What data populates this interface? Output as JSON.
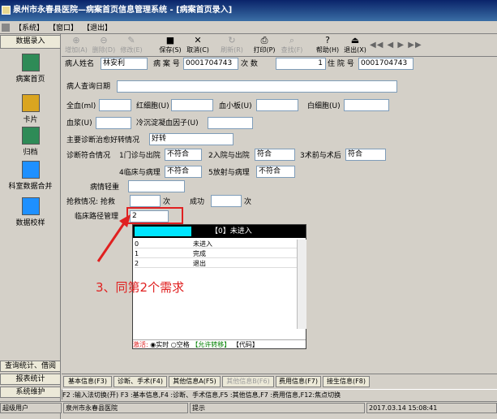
{
  "window": {
    "title": "泉州市永春县医院—病案首页信息管理系统 - [病案首页录入]"
  },
  "menu": [
    "【系统】",
    "【窗口】",
    "【退出】"
  ],
  "sidebar": {
    "header": "数据录入",
    "items": [
      {
        "label": "病案首页",
        "icon": "folder-document-icon",
        "color": "#2e8b57"
      },
      {
        "label": "卡片",
        "icon": "card-icon",
        "color": "#daa520"
      },
      {
        "label": "归档",
        "icon": "archive-icon",
        "color": "#2e8b57"
      },
      {
        "label": "科室数据合并",
        "icon": "merge-icon",
        "color": "#1e90ff"
      },
      {
        "label": "数据校样",
        "icon": "check-data-icon",
        "color": "#1e90ff"
      }
    ],
    "bottom": [
      "查询统计、借阅",
      "报表统计",
      "系统维护"
    ]
  },
  "toolbar": [
    {
      "label": "增加(A)",
      "glyph": "⊕",
      "enabled": false
    },
    {
      "label": "删除(D)",
      "glyph": "⊖",
      "enabled": false
    },
    {
      "label": "修改(E)",
      "glyph": "✎",
      "enabled": false
    },
    {
      "label": "保存(S)",
      "glyph": "■",
      "enabled": true
    },
    {
      "label": "取消(C)",
      "glyph": "✕",
      "enabled": true
    },
    {
      "label": "刷新(R)",
      "glyph": "↻",
      "enabled": false
    },
    {
      "label": "打印(P)",
      "glyph": "⎙",
      "enabled": true
    },
    {
      "label": "查找(F)",
      "glyph": "⌕",
      "enabled": false
    },
    {
      "label": "帮助(H)",
      "glyph": "?",
      "enabled": true
    },
    {
      "label": "退出(X)",
      "glyph": "⏏",
      "enabled": true
    }
  ],
  "nav_arrows": "◀◀ ◀ ▶ ▶▶",
  "form": {
    "row1": {
      "name_label": "病人姓名",
      "name": "林安利",
      "case_label": "病 案 号",
      "case_no": "0001704743",
      "times_label": "次   数",
      "times": "1",
      "inpat_label": "住 院 号",
      "inpat_no": "0001704743"
    },
    "query_date_label": "病人查询日期",
    "blood": {
      "whole": "全血(ml)",
      "rbc": "红细胞(U)",
      "plt": "血小板(U)",
      "wbc": "白细胞(U)",
      "plasma": "血浆(U)",
      "cryo": "冷沉淀凝血因子(U)"
    },
    "diag": {
      "label": "主要诊断治愈好转情况",
      "value": "好转"
    },
    "match": {
      "label": "诊断符合情况",
      "o1": "1门诊与出院",
      "v1": "不符合",
      "o2": "2入院与出院",
      "v2": "符合",
      "o3": "3术前与术后",
      "v3": "符合",
      "o4": "4临床与病理",
      "v4": "不符合",
      "o5": "5放射与病理",
      "v5": "不符合"
    },
    "severity_label": "病情轻重",
    "rescue": {
      "label": "抢救情况: 抢救",
      "unit1": "次",
      "success": "成功",
      "unit2": "次"
    },
    "pathway": {
      "label": "临床路径管理",
      "value": "2"
    }
  },
  "dropdown": {
    "header": "【0】未进入",
    "rows": [
      {
        "code": "0",
        "text": "未进入"
      },
      {
        "code": "1",
        "text": "完成"
      },
      {
        "code": "2",
        "text": "退出"
      }
    ],
    "footer": {
      "label": "激活:",
      "opt1": "实时",
      "opt2": "空格",
      "b1": "【允许转移】",
      "b2": "【代码】"
    }
  },
  "annotation": "3、同第2个需求",
  "tabs": [
    {
      "label": "基本信息(F3)",
      "enabled": true
    },
    {
      "label": "诊断、手术(F4)",
      "enabled": true
    },
    {
      "label": "其他信息A(F5)",
      "enabled": true
    },
    {
      "label": "其他信息B(F6)",
      "enabled": false
    },
    {
      "label": "费用信息(F7)",
      "enabled": true
    },
    {
      "label": "接生信息(F8)",
      "enabled": true
    }
  ],
  "hint": "F2 :输入法切换(开)  F3 :基本信息,F4 :诊断、手术信息,F5 :其他信息,F7 :费用信息,F12:焦点切换",
  "status": {
    "user": "超级用户",
    "hospital": "泉州市永春县医院",
    "tip": "提示",
    "time": "2017.03.14 15:08:41"
  }
}
